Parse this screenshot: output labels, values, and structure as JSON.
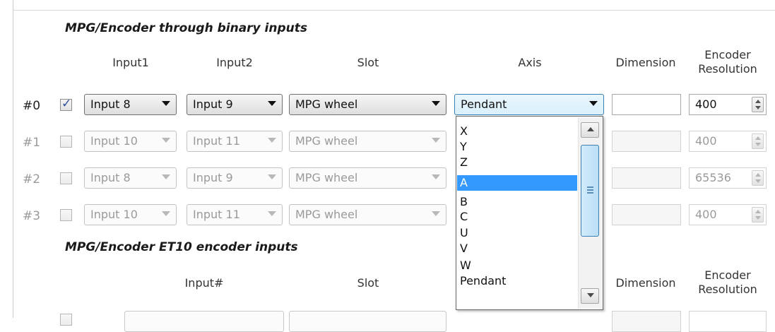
{
  "binary_section": {
    "title": "MPG/Encoder through binary inputs",
    "headers": {
      "input1": "Input1",
      "input2": "Input2",
      "slot": "Slot",
      "axis": "Axis",
      "dimension": "Dimension",
      "resolution_line1": "Encoder",
      "resolution_line2": "Resolution"
    },
    "rows": [
      {
        "label": "#0",
        "checked": true,
        "input1": "Input 8",
        "input2": "Input 9",
        "slot": "MPG wheel",
        "axis": "Pendant",
        "dimension": "",
        "resolution": "400"
      },
      {
        "label": "#1",
        "checked": false,
        "input1": "Input 10",
        "input2": "Input 11",
        "slot": "MPG wheel",
        "axis": "",
        "dimension": "",
        "resolution": "400"
      },
      {
        "label": "#2",
        "checked": false,
        "input1": "Input 8",
        "input2": "Input 9",
        "slot": "MPG wheel",
        "axis": "",
        "dimension": "",
        "resolution": "65536"
      },
      {
        "label": "#3",
        "checked": false,
        "input1": "Input 10",
        "input2": "Input 11",
        "slot": "MPG wheel",
        "axis": "",
        "dimension": "",
        "resolution": "400"
      }
    ]
  },
  "et10_section": {
    "title": "MPG/Encoder ET10 encoder inputs",
    "headers": {
      "input": "Input#",
      "slot": "Slot",
      "dimension": "Dimension",
      "resolution_line1": "Encoder",
      "resolution_line2": "Resolution"
    }
  },
  "axis_dropdown": {
    "options": [
      "X",
      "Y",
      "Z",
      "A",
      "B",
      "C",
      "U",
      "V",
      "W",
      "Pendant"
    ],
    "highlighted": "A"
  },
  "colors": {
    "selection": "#3399ff",
    "focus_border": "#3c7fb1",
    "disabled_text": "#9a9a9a"
  }
}
